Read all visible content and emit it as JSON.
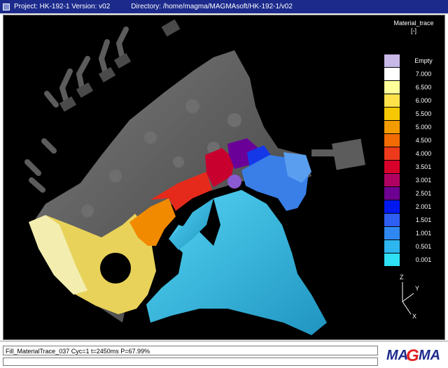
{
  "window": {
    "project_text": "Project: HK-192-1 Version: v02",
    "directory_text": "Directory: /home/magma/MAGMAsoft/HK-192-1/v02"
  },
  "legend": {
    "title": "Material_trace",
    "unit": "[-]",
    "entries": [
      {
        "label": "Empty",
        "color": "#c8b8e8"
      },
      {
        "label": "7.000",
        "color": "#ffffff"
      },
      {
        "label": "6.500",
        "color": "#ffff9a"
      },
      {
        "label": "6.000",
        "color": "#ffe24a"
      },
      {
        "label": "5.500",
        "color": "#f7c800"
      },
      {
        "label": "5.000",
        "color": "#f49b00"
      },
      {
        "label": "4.500",
        "color": "#f26a00"
      },
      {
        "label": "4.000",
        "color": "#ee3a1c"
      },
      {
        "label": "3.501",
        "color": "#d8002a"
      },
      {
        "label": "3.001",
        "color": "#b00060"
      },
      {
        "label": "2.501",
        "color": "#6c0090"
      },
      {
        "label": "2.001",
        "color": "#0018f0"
      },
      {
        "label": "1.501",
        "color": "#2f5ef4"
      },
      {
        "label": "1.001",
        "color": "#2f88f0"
      },
      {
        "label": "0.501",
        "color": "#2eb6f0"
      },
      {
        "label": "0.001",
        "color": "#2ee0f4"
      }
    ]
  },
  "axes": {
    "z": "Z",
    "y": "Y",
    "x": "X"
  },
  "status": {
    "line": "Fill_MaterialTrace_037 Cyc=1 t=2450ms P=67.99%"
  },
  "logo": {
    "text": "MAGMA"
  },
  "colors": {
    "title_bar": "#1c2a8c",
    "casting_grey": "#5a5a5a",
    "runner_cyan": "#2bb8e0"
  }
}
